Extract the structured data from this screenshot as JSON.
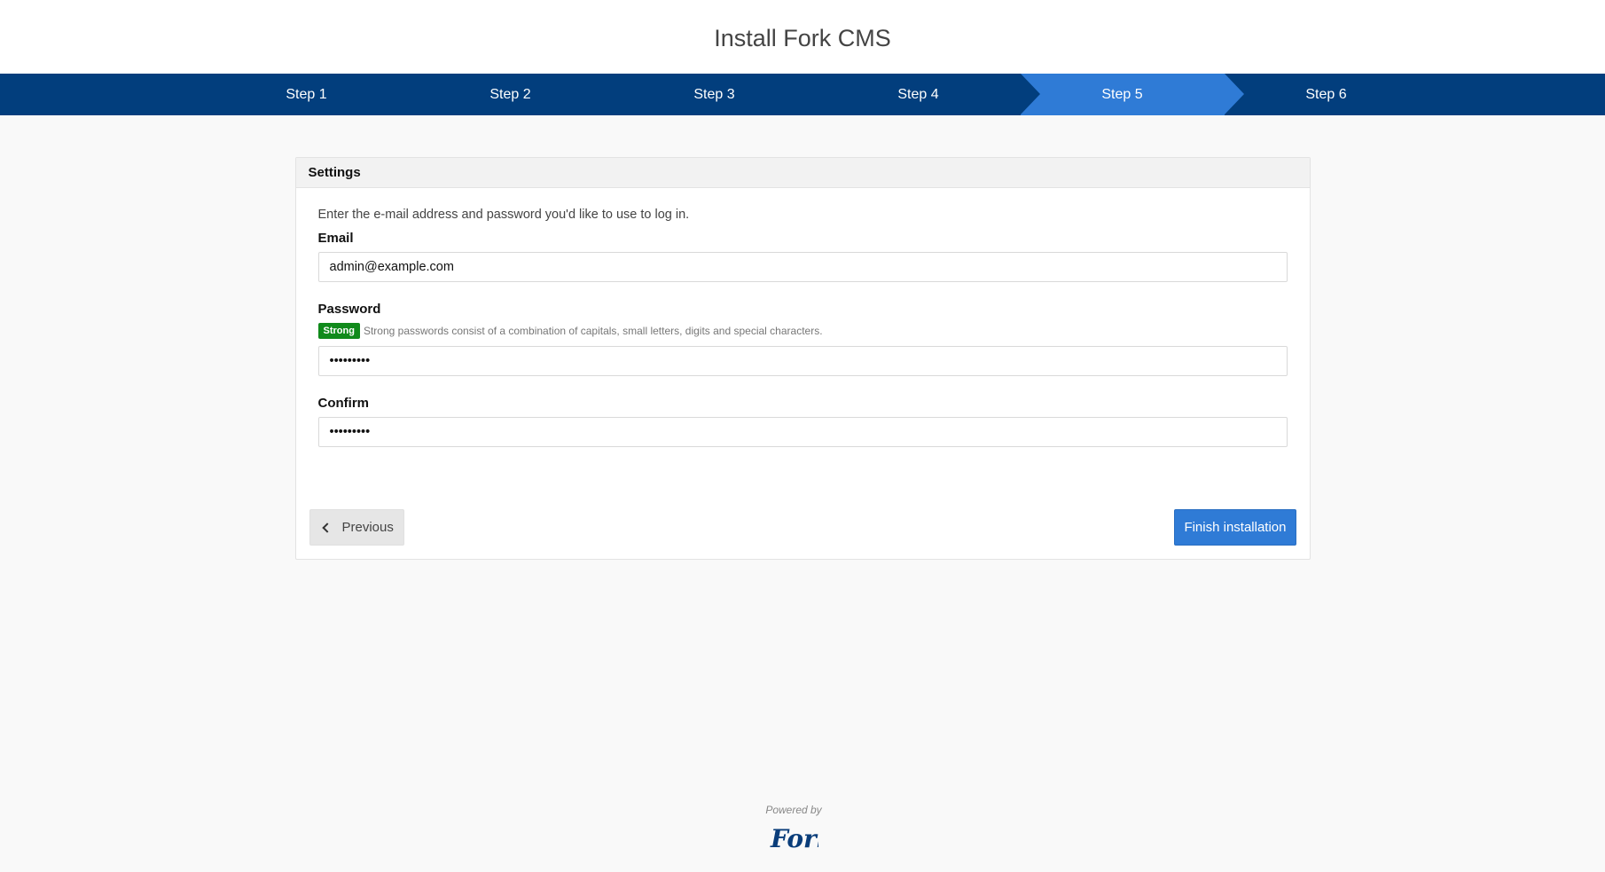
{
  "header": {
    "title": "Install Fork CMS"
  },
  "steps": [
    {
      "label": "Step 1",
      "active": false
    },
    {
      "label": "Step 2",
      "active": false
    },
    {
      "label": "Step 3",
      "active": false
    },
    {
      "label": "Step 4",
      "active": false
    },
    {
      "label": "Step 5",
      "active": true
    },
    {
      "label": "Step 6",
      "active": false
    }
  ],
  "panel": {
    "heading": "Settings",
    "intro": "Enter the e-mail address and password you'd like to use to log in.",
    "email": {
      "label": "Email",
      "value": "admin@example.com"
    },
    "password": {
      "label": "Password",
      "strength_badge": "Strong",
      "strength_help": "Strong passwords consist of a combination of capitals, small letters, digits and special characters.",
      "value": "•••••••••"
    },
    "confirm": {
      "label": "Confirm",
      "value": "•••••••••"
    }
  },
  "buttons": {
    "previous": "Previous",
    "finish": "Finish installation"
  },
  "footer": {
    "powered_by": "Powered by",
    "logo_text": "Fork"
  },
  "colors": {
    "steps_bar": "#023e7d",
    "active_step": "#2f7bd6",
    "strong_badge": "#108a1b",
    "logo": "#0a3d7a"
  },
  "icons": {
    "previous": "chevron-left-icon"
  }
}
